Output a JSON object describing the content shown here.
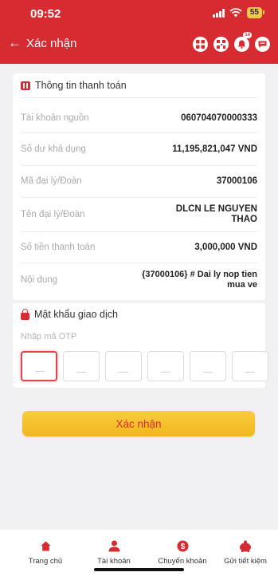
{
  "status": {
    "time": "09:52",
    "battery": "55"
  },
  "nav": {
    "title": "Xác nhận",
    "notification_badge": "14"
  },
  "payment_info": {
    "title": "Thông tin thanh toán",
    "rows": [
      {
        "label": "Tài khoản nguồn",
        "value": "060704070000333"
      },
      {
        "label": "Số dư khả dụng",
        "value": "11,195,821,047 VND"
      },
      {
        "label": "Mã đại lý/Đoàn",
        "value": "37000106"
      },
      {
        "label": "Tên đại lý/Đoàn",
        "value": "DLCN LE NGUYEN THAO"
      },
      {
        "label": "Số tiền thanh toán",
        "value": "3,000,000 VND"
      },
      {
        "label": "Nội dung",
        "value": "{37000106} # Dai ly nop tien mua ve"
      }
    ]
  },
  "otp": {
    "title": "Mật khẩu giao dịch",
    "placeholder": "Nhập mã OTP",
    "box_count": 6
  },
  "confirm_label": "Xác nhận",
  "bottom_nav": [
    {
      "label": "Trang chủ",
      "icon": "home-icon"
    },
    {
      "label": "Tài khoản",
      "icon": "user-icon"
    },
    {
      "label": "Chuyển khoản",
      "icon": "transfer-icon"
    },
    {
      "label": "Gửi tiết kiệm",
      "icon": "piggy-bank-icon"
    }
  ],
  "colors": {
    "brand_red": "#d72b32",
    "accent_yellow": "#f5c02a"
  }
}
